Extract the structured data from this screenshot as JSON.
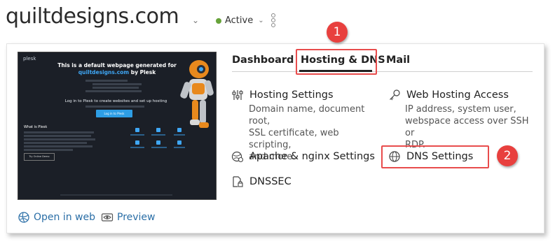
{
  "header": {
    "domain": "quiltdesigns.com",
    "status": "Active"
  },
  "preview": {
    "brand": "plesk",
    "headline_1": "This is a default webpage generated for",
    "headline_link": "quiltdesigns.com",
    "headline_2": "by Plesk",
    "login_heading": "Log in to Plesk to create websites and set up hosting",
    "login_button": "Log in to Plesk",
    "what_heading": "What is Plesk",
    "demo_button": "Try Online Demo"
  },
  "tabs": [
    {
      "label": "Dashboard"
    },
    {
      "label": "Hosting & DNS"
    },
    {
      "label": "Mail"
    }
  ],
  "items": {
    "hosting_settings": {
      "title": "Hosting Settings",
      "desc_lines": [
        "Domain name, document root,",
        "SSL certificate, web scripting,",
        "and more."
      ]
    },
    "web_hosting_access": {
      "title": "Web Hosting Access",
      "desc_lines": [
        "IP address, system user,",
        "webspace access over SSH or",
        "RDP."
      ]
    },
    "apache": {
      "title": "Apache & nginx Settings"
    },
    "dns_settings": {
      "title": "DNS Settings"
    },
    "dnssec": {
      "title": "DNSSEC"
    }
  },
  "links": {
    "open_in_web": "Open in web",
    "preview": "Preview"
  },
  "annotations": {
    "badge_1": "1",
    "badge_2": "2"
  },
  "colors": {
    "highlight": "#e84c4c",
    "badge": "#e8403e",
    "active_dot": "#67a33a",
    "link": "#2a6ea6"
  }
}
